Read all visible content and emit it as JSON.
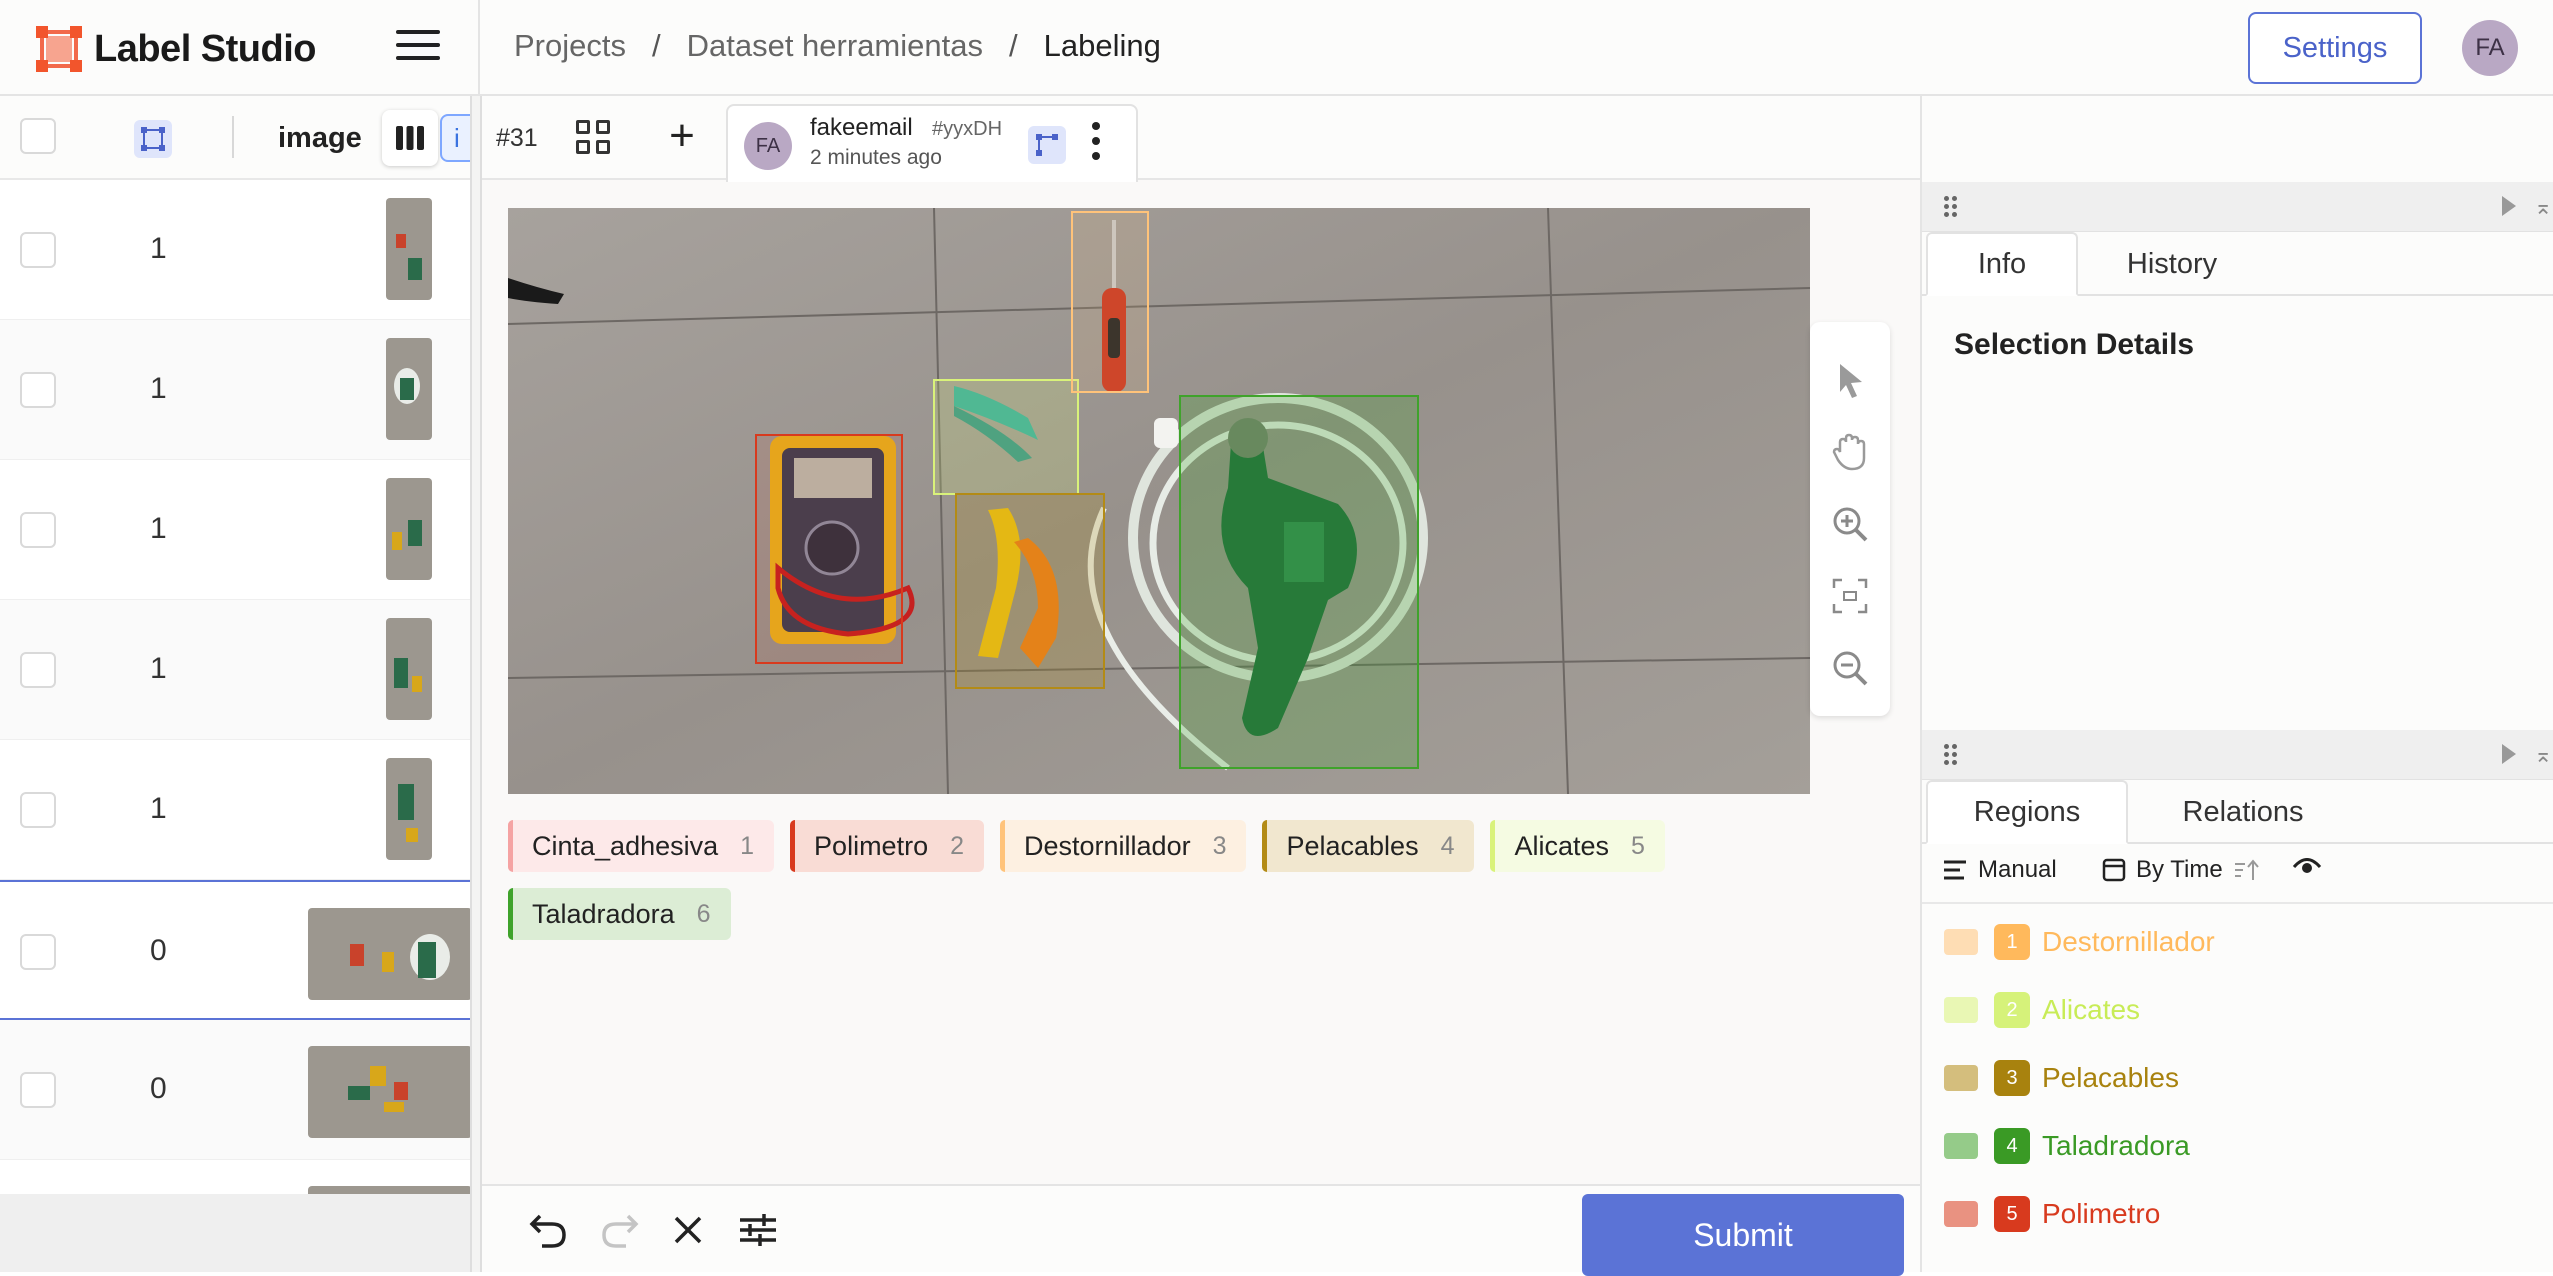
{
  "app": {
    "name": "Label Studio"
  },
  "breadcrumb": {
    "projects": "Projects",
    "dataset": "Dataset herramientas",
    "current": "Labeling",
    "sep": "/"
  },
  "header": {
    "settings_label": "Settings",
    "user_initials": "FA"
  },
  "task_list": {
    "column_image": "image",
    "rows": [
      {
        "count": "1"
      },
      {
        "count": "1"
      },
      {
        "count": "1"
      },
      {
        "count": "1"
      },
      {
        "count": "1"
      },
      {
        "count": "0"
      },
      {
        "count": "0"
      }
    ]
  },
  "toolbar": {
    "task_id": "#31"
  },
  "annotation": {
    "initials": "FA",
    "user": "fakeemail",
    "id": "#yyxDH",
    "time": "2 minutes ago"
  },
  "labels": [
    {
      "name": "Cinta_adhesiva",
      "hotkey": "1",
      "color": "#f5a3a3",
      "bg": "#fde9e9"
    },
    {
      "name": "Polimetro",
      "hotkey": "2",
      "color": "#d83a1e",
      "bg": "#f9dcd5"
    },
    {
      "name": "Destornillador",
      "hotkey": "3",
      "color": "#ffc37a",
      "bg": "#fdf0e1"
    },
    {
      "name": "Pelacables",
      "hotkey": "4",
      "color": "#b38b16",
      "bg": "#f1e7cf"
    },
    {
      "name": "Alicates",
      "hotkey": "5",
      "color": "#d9f27a",
      "bg": "#f5fbe2"
    },
    {
      "name": "Taladradora",
      "hotkey": "6",
      "color": "#3fa32b",
      "bg": "#dcedd5"
    }
  ],
  "right_panel": {
    "tab_info": "Info",
    "tab_history": "History",
    "selection_title": "Selection Details",
    "tab_regions": "Regions",
    "tab_relations": "Relations",
    "order_manual": "Manual",
    "order_by_time": "By Time"
  },
  "regions": [
    {
      "num": "1",
      "label": "Destornillador",
      "color": "#ffb95c"
    },
    {
      "num": "2",
      "label": "Alicates",
      "color": "#c8ec57"
    },
    {
      "num": "3",
      "label": "Pelacables",
      "color": "#a8820e"
    },
    {
      "num": "4",
      "label": "Taladradora",
      "color": "#3a9a25"
    },
    {
      "num": "5",
      "label": "Polimetro",
      "color": "#d83a1e"
    }
  ],
  "bottom": {
    "submit_label": "Submit"
  },
  "colors": {
    "accent": "#5b73d6"
  }
}
